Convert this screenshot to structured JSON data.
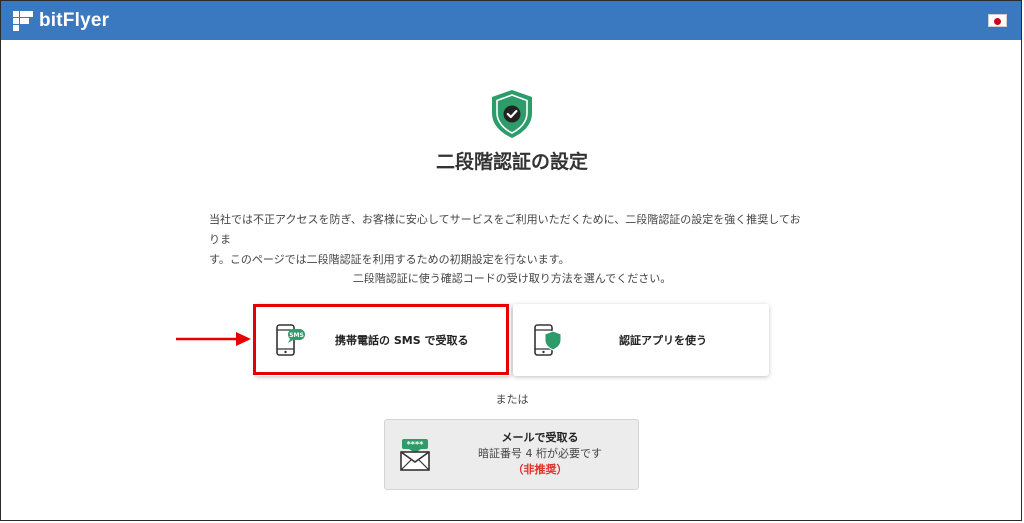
{
  "header": {
    "brand": "bitFlyer",
    "logo_icon": "bitflyer-logo-icon",
    "language_flag": "japan-flag-icon"
  },
  "page": {
    "title": "二段階認証の設定",
    "description_line1": "当社では不正アクセスを防ぎ、お客様に安心してサービスをご利用いただくために、二段階認証の設定を強く推奨しておりま",
    "description_line2": "す。このページでは二段階認証を利用するための初期設定を行ないます。",
    "instruction": "二段階認証に使う確認コードの受け取り方法を選んでください。",
    "or_text": "または"
  },
  "options": {
    "sms_label": "携帯電話の SMS で受取る",
    "sms_badge": "SMS",
    "app_label": "認証アプリを使う"
  },
  "email_option": {
    "title": "メールで受取る",
    "subtitle": "暗証番号 4 桁が必要です",
    "warning": "（非推奨）",
    "dots": "****"
  },
  "colors": {
    "header_bg": "#3a78c0",
    "accent_green": "#2e9b6b",
    "highlight_red": "#e60000",
    "warning_red": "#e0302a"
  }
}
